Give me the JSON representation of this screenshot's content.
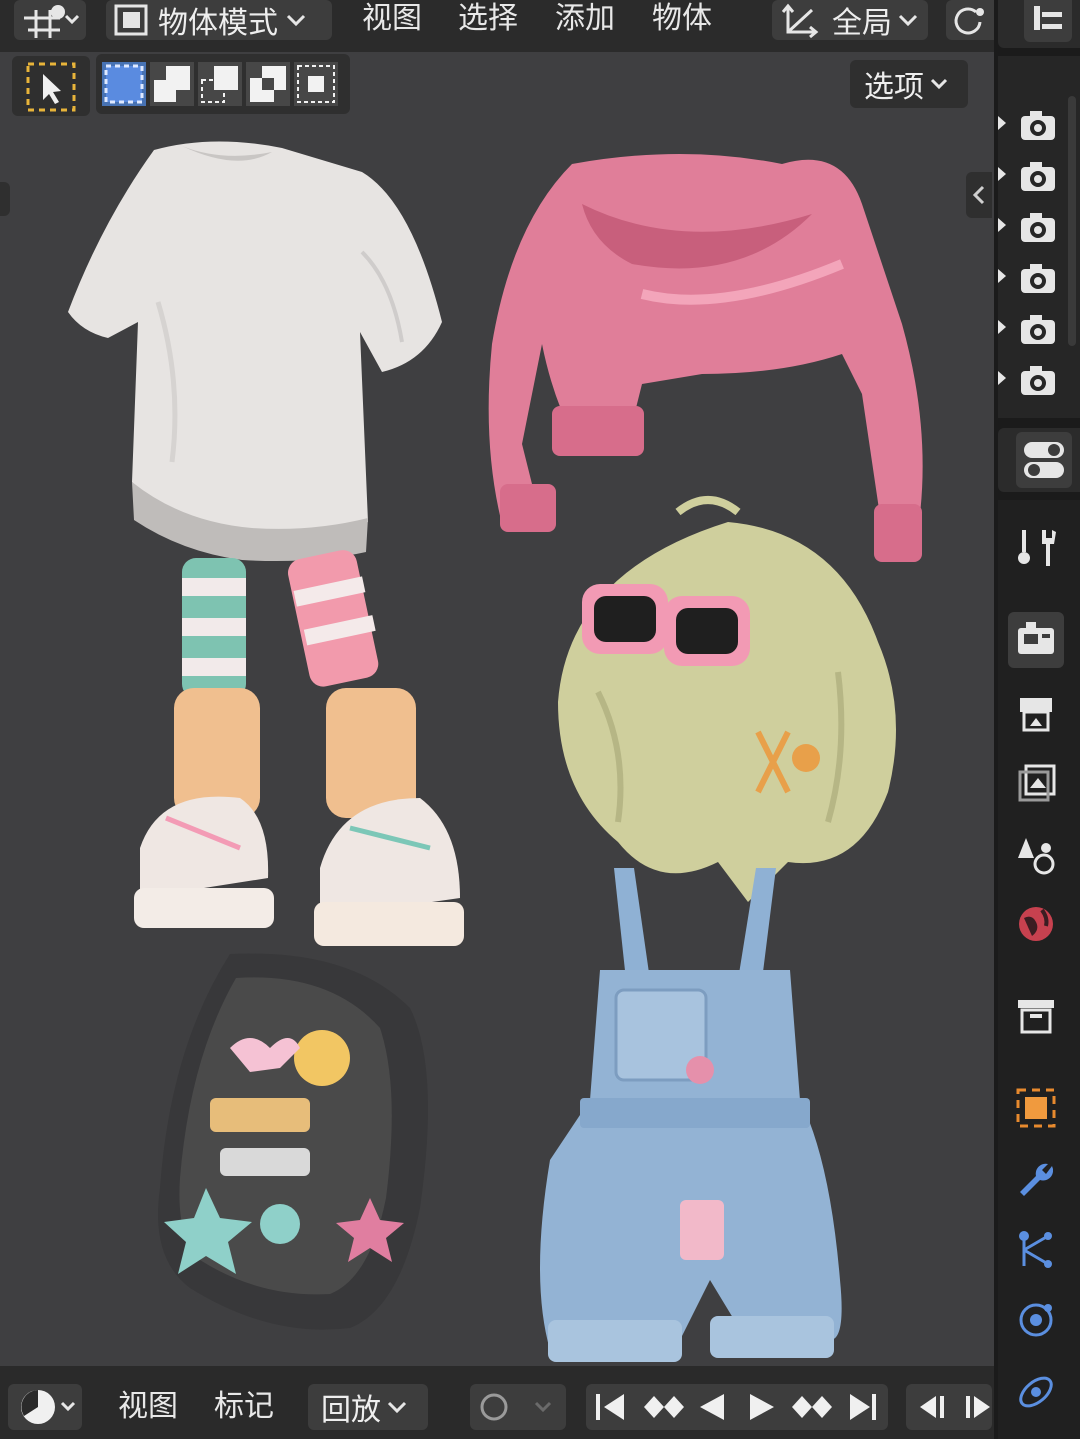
{
  "header": {
    "mode_label": "物体模式",
    "menus": [
      "视图",
      "选择",
      "添加",
      "物体"
    ],
    "transform_orientation": "全局"
  },
  "viewport": {
    "options_label": "选项",
    "assets": [
      {
        "name": "white-tshirt",
        "color": "#e6e3e1"
      },
      {
        "name": "pink-sweater",
        "color": "#e27f9b"
      },
      {
        "name": "striped-socks-sneakers",
        "color": "#f2c79c"
      },
      {
        "name": "blonde-hair-sunglasses",
        "color": "#cfcf9a"
      },
      {
        "name": "black-backpack-patches",
        "color": "#3b3a3a"
      },
      {
        "name": "denim-overalls",
        "color": "#93b3d4"
      }
    ]
  },
  "timeline": {
    "menus": [
      "视图",
      "标记"
    ],
    "playback_label": "回放"
  },
  "colors": {
    "accent_blue": "#4772b3",
    "accent_orange": "#e88a2e",
    "viewport_bg": "#3f3f41",
    "header_bg": "#2b2b2b"
  },
  "outliner_rows": 6
}
